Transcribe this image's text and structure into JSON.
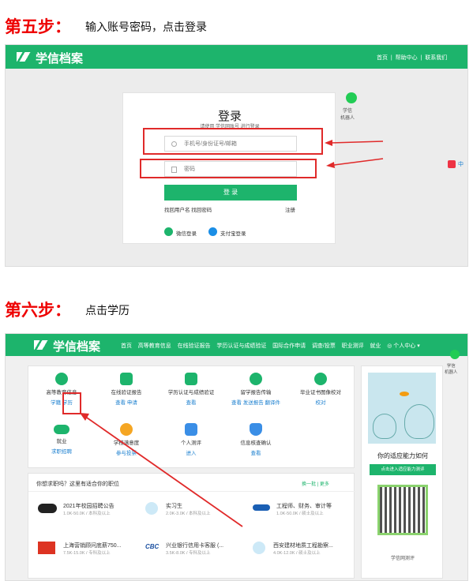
{
  "step5": {
    "label": "第五步：",
    "desc": "输入账号密码，点击登录"
  },
  "login_page": {
    "logo": "学信档案",
    "nav": [
      "首页",
      "帮助中心",
      "联系我们"
    ],
    "title": "登录",
    "subtitle": "请使用 学信网账号 进行登录",
    "username_placeholder": "手机号/身份证号/邮箱",
    "password_placeholder": "密码",
    "login_button": "登 录",
    "forgot_links": "找回用户名  找回密码",
    "register": "注册",
    "wechat_login": "微信登录",
    "alipay_login": "支付宝登录",
    "robot_label": "学信\n机器人",
    "side_badge": "中"
  },
  "step6": {
    "label": "第六步：",
    "desc": "点击学历"
  },
  "main_page": {
    "logo": "学信档案",
    "menu": [
      "首页",
      "高等教育信息",
      "在线验证报告",
      "学历认证与成绩验证",
      "国际合作申请",
      "调查/投票",
      "职业测评",
      "就业",
      "◎ 个人中心 ▾"
    ],
    "tiles": [
      {
        "name": "高等教育信息",
        "sub": "学籍  学历",
        "color": "#1db46c"
      },
      {
        "name": "在线验证报告",
        "sub": "查看  申请",
        "color": "#1db46c"
      },
      {
        "name": "学历认证与成绩验证",
        "sub": "查看",
        "color": "#1db46c"
      },
      {
        "name": "留学报告传输",
        "sub": "查看  发送报告  翻译件",
        "color": "#3a8ee6"
      },
      {
        "name": "毕业证书图像校对",
        "sub": "校对",
        "color": "#1db46c"
      },
      {
        "name": "就业",
        "sub": "求职招聘",
        "color": "#1db46c"
      },
      {
        "name": "学校满意度",
        "sub": "参与投票",
        "color": "#f5a623"
      },
      {
        "name": "个人测评",
        "sub": "进入",
        "color": "#3a8ee6"
      },
      {
        "name": "信息核查确认",
        "sub": "查看",
        "color": "#3a8ee6"
      }
    ],
    "jobs_title": "你想求职吗？这里有适合你的职位",
    "jobs_links": "换一批  |  更多",
    "jobs": [
      {
        "title": "2021年校园招聘公告",
        "meta": "1.0K-50.0K / 本科及以上"
      },
      {
        "title": "实习生",
        "meta": "2.0K-3.0K / 本科及以上"
      },
      {
        "title": "工程师、财务、审计等",
        "meta": "1.0K-50.0K / 硕士及以上"
      },
      {
        "title": "上海营销顾问底薪750...",
        "meta": "7.5K-15.0K / 专科及以上"
      },
      {
        "title": "兴业银行信用卡客服 (...",
        "meta": "3.5K-8.0K / 专科及以上"
      },
      {
        "title": "西安建材地质工程勘察...",
        "meta": "4.0K-12.0K / 硕士及以上"
      }
    ],
    "ability_title": "你的适应能力如何",
    "ability_button": "点击进入适应能力测评",
    "qr_caption": "学信网测评",
    "robot_label": "学信\n机器人"
  }
}
